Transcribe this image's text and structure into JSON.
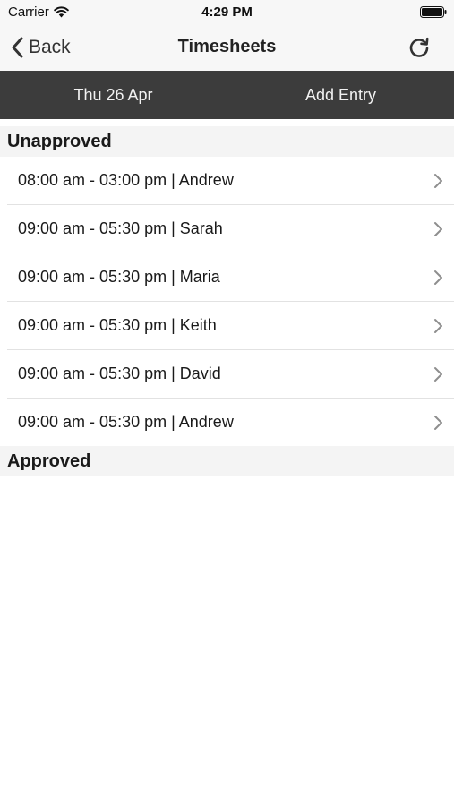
{
  "status_bar": {
    "carrier": "Carrier",
    "time": "4:29 PM"
  },
  "nav": {
    "back_label": "Back",
    "title": "Timesheets"
  },
  "toolbar": {
    "date_label": "Thu 26 Apr",
    "add_entry_label": "Add Entry"
  },
  "sections": {
    "unapproved_title": "Unapproved",
    "approved_title": "Approved"
  },
  "unapproved_entries": [
    "08:00 am - 03:00 pm | Andrew",
    "09:00 am - 05:30 pm | Sarah",
    "09:00 am - 05:30 pm | Maria",
    "09:00 am - 05:30 pm | Keith",
    "09:00 am - 05:30 pm | David",
    "09:00 am - 05:30 pm | Andrew"
  ],
  "icons": {
    "wifi": "wifi-icon",
    "battery": "battery-icon",
    "back": "chevron-left-icon",
    "refresh": "refresh-icon",
    "row": "chevron-right-icon"
  },
  "colors": {
    "toolbar_bg": "#3c3c3c",
    "section_bg": "#f4f4f4",
    "nav_bg": "#f7f7f7"
  }
}
